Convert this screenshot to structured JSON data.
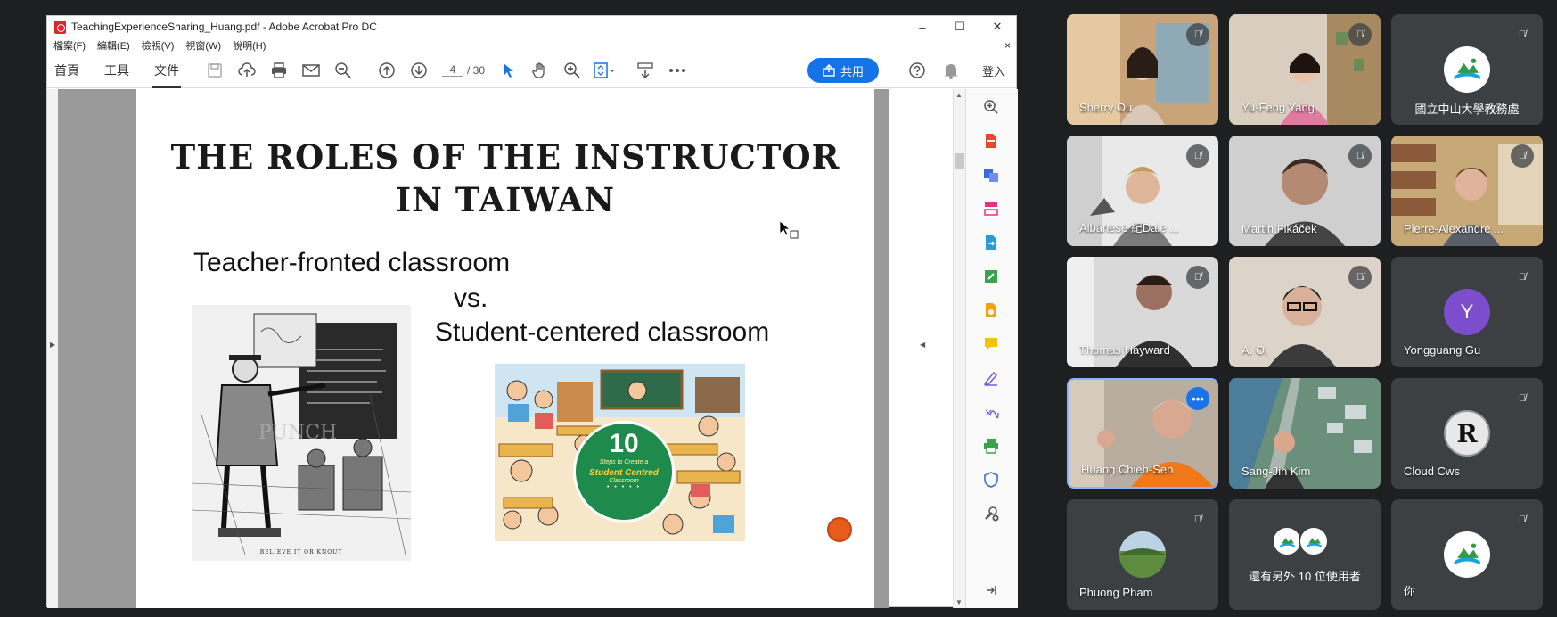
{
  "acrobat": {
    "title": "TeachingExperienceSharing_Huang.pdf - Adobe Acrobat Pro DC",
    "window_buttons": {
      "minimize": "–",
      "maximize": "☐",
      "close": "✕"
    },
    "menu": [
      "檔案(F)",
      "編輯(E)",
      "檢視(V)",
      "視窗(W)",
      "說明(H)"
    ],
    "menu_close": "×",
    "tabs": [
      "首頁",
      "工具",
      "文件"
    ],
    "page_current": "4",
    "page_total": "/ 30",
    "share_label": "共用",
    "login_label": "登入"
  },
  "slide": {
    "title_line1": "THE ROLES OF THE INSTRUCTOR",
    "title_line2": "IN TAIWAN",
    "text1": "Teacher-fronted classroom",
    "text2": "vs.",
    "text3": "Student-centered classroom",
    "cartoon_caption": "BELIEVE IT OR KNOUT",
    "badge_num": "10",
    "badge_line1": "Steps to Create a",
    "badge_line2": "Student Centred",
    "badge_line3": "Classroom",
    "badge_dots": "• • • • •"
  },
  "meet": {
    "participants": [
      {
        "name": "Sherry Ou"
      },
      {
        "name": "Yu-Feng Yang"
      },
      {
        "name": "國立中山大學教務處"
      },
      {
        "name": "Albanese 紀Dale ..."
      },
      {
        "name": "Martin Fikáček"
      },
      {
        "name": "Pierre-Alexandre ..."
      },
      {
        "name": "Thomas Hayward"
      },
      {
        "name": "A. O."
      },
      {
        "name": "Yongguang Gu",
        "initial": "Y"
      },
      {
        "name": "Huang Chieh-Sen"
      },
      {
        "name": "Sang-Jin Kim"
      },
      {
        "name": "Cloud Cws",
        "initial": "R"
      },
      {
        "name": "Phuong Pham"
      },
      {
        "name": "還有另外 10 位使用者"
      },
      {
        "name": "你"
      }
    ],
    "colors": {
      "tile": "#3c4043",
      "accent": "#1a73e8",
      "avatar_y": "#7c4dcc"
    }
  }
}
